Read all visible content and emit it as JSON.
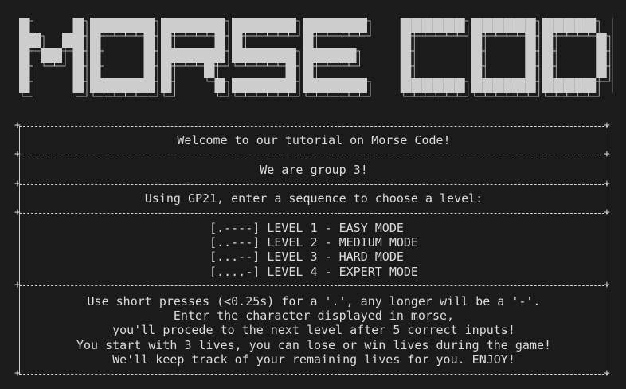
{
  "window": {
    "banner_title": "MORSE CODE"
  },
  "sections": {
    "welcome": "Welcome to our tutorial on Morse Code!",
    "group": "We are group 3!",
    "instruction": "Using GP21, enter a sequence to choose a level:",
    "levels": [
      "[.----] LEVEL 1 - EASY MODE  ",
      "[..---] LEVEL 2 - MEDIUM MODE",
      "[...--] LEVEL 3 - HARD MODE  ",
      "[....-] LEVEL 4 - EXPERT MODE"
    ],
    "rules": [
      "Use short presses (<0.25s) for a '.', any longer will be a '-'.",
      "Enter the character displayed in morse,",
      "you'll procede to the next level after 5 correct inputs!",
      "You start with 3 lives, you can lose or win lives during the game!",
      "We'll keep track of your remaining lives for you. ENJOY!"
    ]
  },
  "colors": {
    "background": "#1b1b1b",
    "text": "#dcdcdc",
    "banner_fill": "#cdcdcd"
  }
}
